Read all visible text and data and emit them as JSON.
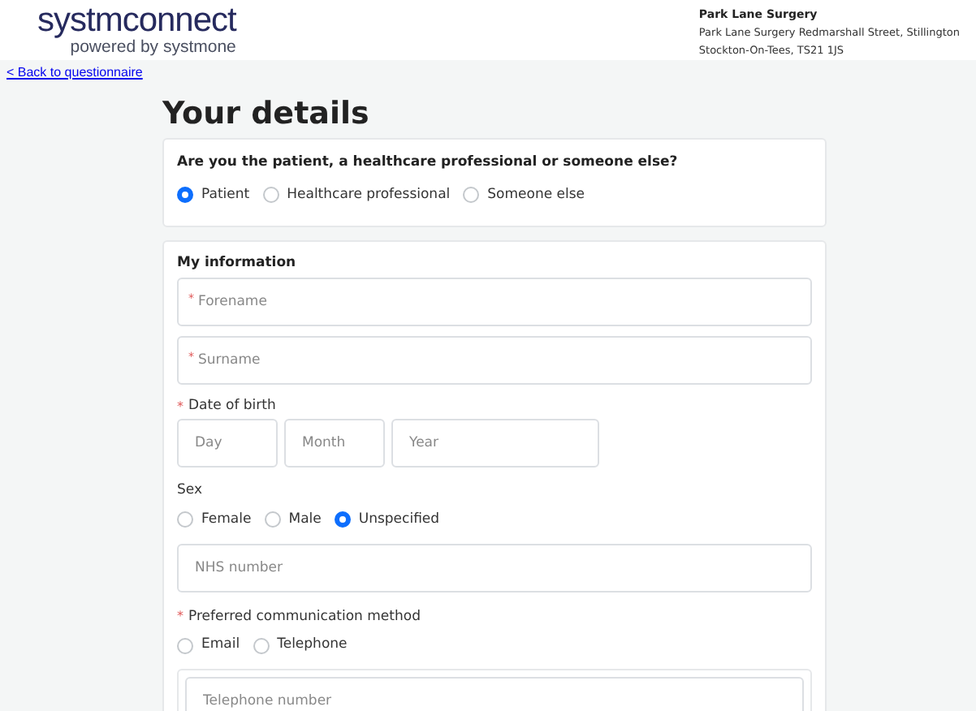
{
  "header": {
    "logo": "systmconnect",
    "logo_tagline": "powered by systmone",
    "practice_name": "Park Lane Surgery",
    "practice_address": [
      "Park Lane Surgery Redmarshall Street, Stillington",
      "Stockton-On-Tees, TS21 1JS"
    ]
  },
  "back_link": "< Back to questionnaire",
  "title": "Your details",
  "respondent": {
    "question": "Are you the patient, a healthcare professional or someone else?",
    "options": [
      {
        "label": "Patient",
        "selected": true
      },
      {
        "label": "Healthcare professional",
        "selected": false
      },
      {
        "label": "Someone else",
        "selected": false
      }
    ]
  },
  "my_information": {
    "heading": "My information",
    "forename": {
      "required_mark": "*",
      "placeholder": "Forename"
    },
    "surname": {
      "required_mark": "*",
      "placeholder": "Surname"
    },
    "date_of_birth": {
      "required_mark": "*",
      "label": "Date of birth",
      "parts": [
        {
          "placeholder": "Day"
        },
        {
          "placeholder": "Month"
        },
        {
          "placeholder": "Year"
        }
      ]
    },
    "sex": {
      "label": "Sex",
      "options": [
        {
          "label": "Female",
          "selected": false
        },
        {
          "label": "Male",
          "selected": false
        },
        {
          "label": "Unspecified",
          "selected": true
        }
      ]
    },
    "nhs_number": {
      "placeholder": "NHS number"
    },
    "communication": {
      "required_mark": "*",
      "label": "Preferred communication method",
      "options": [
        {
          "label": "Email",
          "selected": false
        },
        {
          "label": "Telephone",
          "selected": false
        }
      ]
    },
    "telephone": {
      "placeholder": "Telephone number"
    }
  }
}
